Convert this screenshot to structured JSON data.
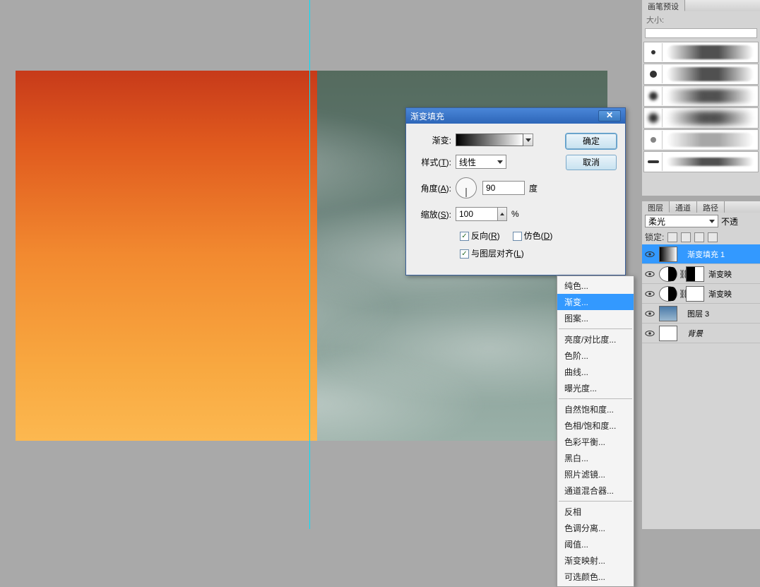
{
  "dialog": {
    "title": "渐变填充",
    "gradient_label": "渐变:",
    "style_label_pre": "样式(",
    "style_label_u": "T",
    "style_label_post": "):",
    "style_value": "线性",
    "angle_label_pre": "角度(",
    "angle_label_u": "A",
    "angle_label_post": "):",
    "angle_value": "90",
    "angle_unit": "度",
    "scale_label_pre": "缩放(",
    "scale_label_u": "S",
    "scale_label_post": "):",
    "scale_value": "100",
    "scale_unit": "%",
    "reverse_pre": "反向(",
    "reverse_u": "R",
    "reverse_post": ")",
    "dither_pre": "仿色(",
    "dither_u": "D",
    "dither_post": ")",
    "align_pre": "与图层对齐(",
    "align_u": "L",
    "align_post": ")",
    "ok": "确定",
    "cancel": "取消"
  },
  "ctx": {
    "items": [
      "纯色...",
      "渐变...",
      "图案...",
      "亮度/对比度...",
      "色阶...",
      "曲线...",
      "曝光度...",
      "自然饱和度...",
      "色相/饱和度...",
      "色彩平衡...",
      "黑白...",
      "照片滤镜...",
      "通道混合器...",
      "反相",
      "色调分离...",
      "阈值...",
      "渐变映射...",
      "可选颜色..."
    ]
  },
  "brush": {
    "tab": "画笔预设",
    "size_label": "大小:"
  },
  "layers": {
    "tabs": [
      "图层",
      "通道",
      "路径"
    ],
    "blend": "柔光",
    "opacity_label": "不透",
    "lock_label": "锁定:",
    "rows": [
      {
        "name": "渐变填充 1"
      },
      {
        "name": "渐变映"
      },
      {
        "name": "渐变映"
      },
      {
        "name": "图层 3"
      },
      {
        "name": "背景"
      }
    ]
  }
}
